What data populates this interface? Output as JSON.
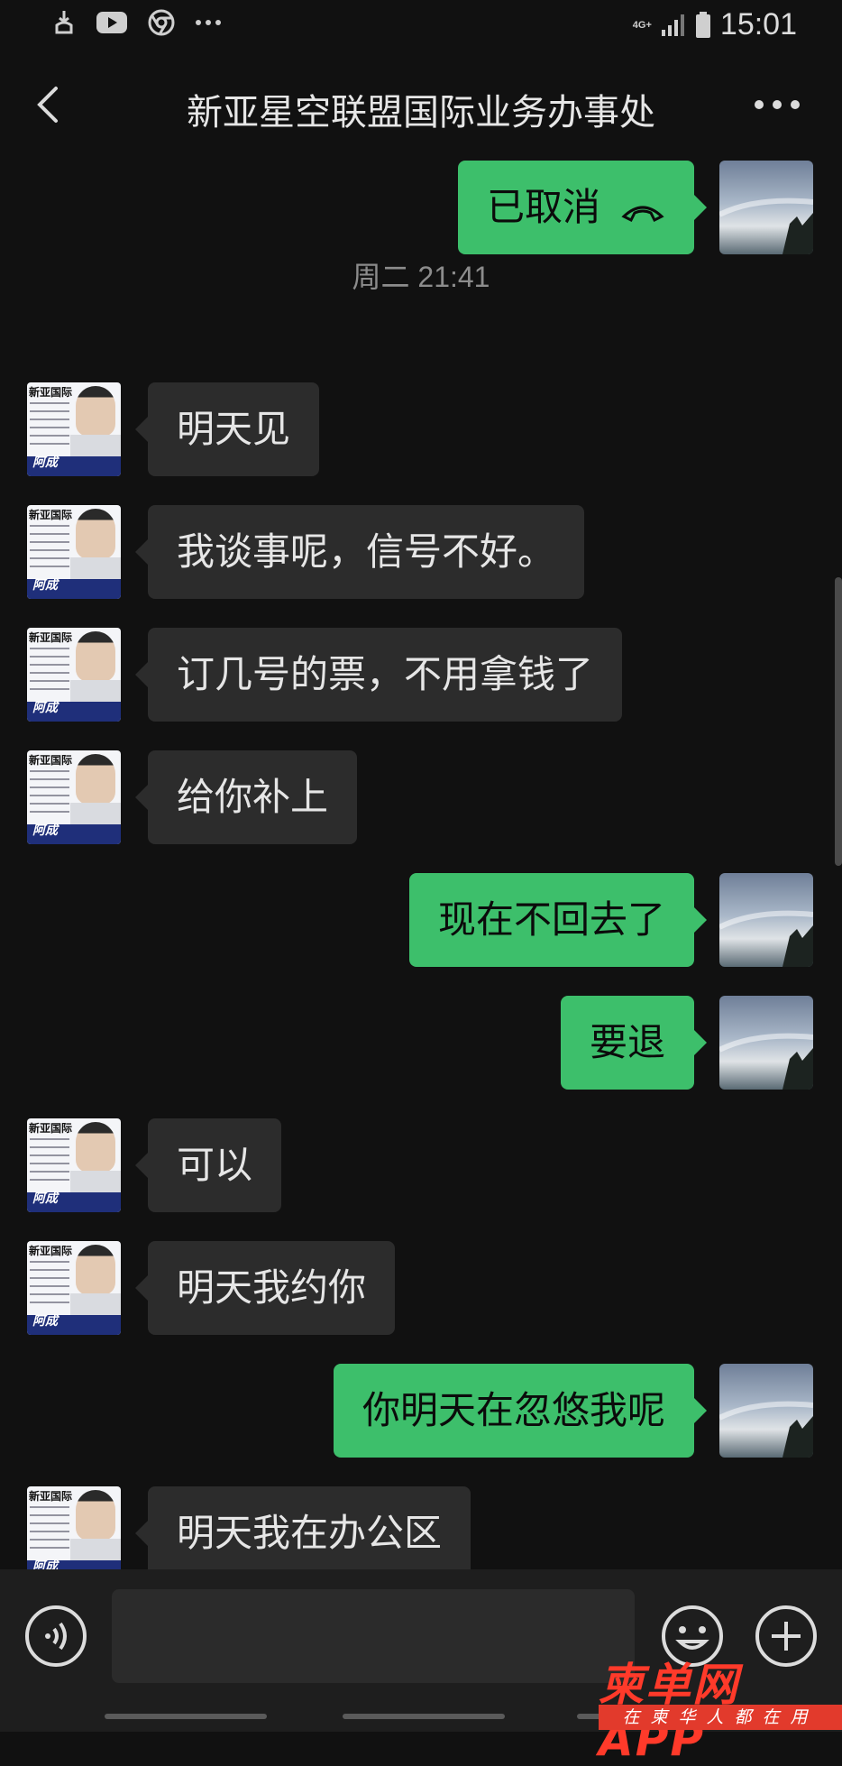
{
  "status_bar": {
    "time": "15:01",
    "network": "4G+",
    "icons": [
      "notification-icon",
      "youtube-icon",
      "chrome-icon",
      "more-notifications-icon",
      "signal-icon",
      "battery-icon"
    ]
  },
  "header": {
    "title": "新亚星空联盟国际业务办事处",
    "back_icon": "chevron-left-icon",
    "more_icon": "more-dots-icon"
  },
  "contact_avatar": {
    "line1": "新亚国际",
    "name": "阿成"
  },
  "messages": [
    {
      "dir": "out",
      "text": "已取消",
      "icon": "call-ended-icon"
    },
    {
      "type": "time",
      "text": "周二 21:41"
    },
    {
      "dir": "in",
      "text": "明天见"
    },
    {
      "dir": "in",
      "text": "我谈事呢，信号不好。"
    },
    {
      "dir": "in",
      "text": "订几号的票，不用拿钱了"
    },
    {
      "dir": "in",
      "text": "给你补上"
    },
    {
      "dir": "out",
      "text": "现在不回去了"
    },
    {
      "dir": "out",
      "text": "要退"
    },
    {
      "dir": "in",
      "text": "可以"
    },
    {
      "dir": "in",
      "text": "明天我约你"
    },
    {
      "dir": "out",
      "text": "你明天在忽悠我呢"
    },
    {
      "dir": "in",
      "text": "明天我在办公区"
    }
  ],
  "input_bar": {
    "voice_icon": "voice-input-icon",
    "emoji_icon": "emoji-icon",
    "plus_icon": "plus-icon",
    "placeholder": ""
  },
  "watermark": {
    "main": "柬单网APP",
    "sub": "在柬华人都在用"
  },
  "colors": {
    "background": "#111111",
    "outgoing_bubble": "#3dbf6b",
    "incoming_bubble": "#2c2c2c",
    "watermark_red": "#e23a2c"
  }
}
